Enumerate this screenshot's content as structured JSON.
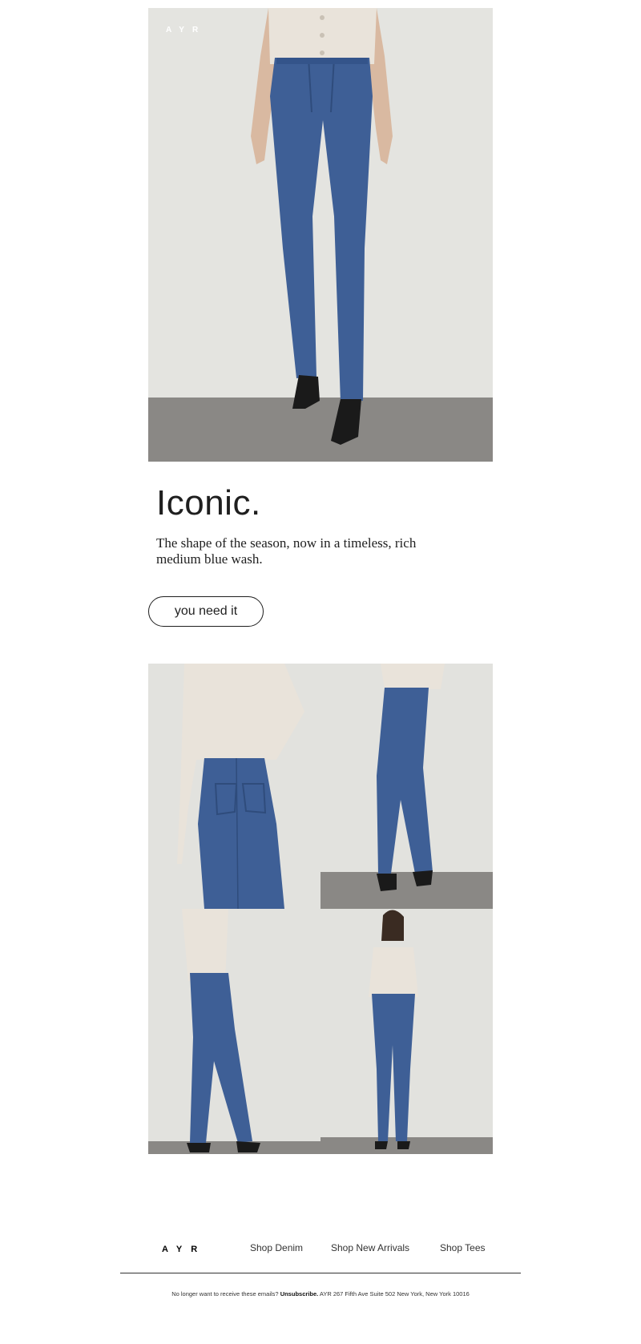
{
  "hero": {
    "logo": "AYR",
    "image": "model-wearing-medium-blue-jeans"
  },
  "promo": {
    "headline": "Iconic.",
    "body": "The shape of the season, now in a timeless, rich medium blue wash.",
    "cta_label": "you need it"
  },
  "gallery": {
    "images": [
      "jeans-back-view",
      "jeans-side-view",
      "jeans-side-back-view",
      "jeans-front-full-view"
    ]
  },
  "footer": {
    "logo": "AYR",
    "links": [
      "Shop Denim",
      "Shop New Arrivals",
      "Shop Tees"
    ],
    "legal_prefix": "No longer want to receive these emails?",
    "unsubscribe_label": "Unsubscribe.",
    "address": "AYR 267 Fifth Ave Suite 502 New York, New York 10016"
  },
  "colors": {
    "wall": "#e4e4e0",
    "floor": "#8a8885",
    "denim": "#3e5f96",
    "sweater": "#e9e3da",
    "text": "#1f1f1f"
  }
}
